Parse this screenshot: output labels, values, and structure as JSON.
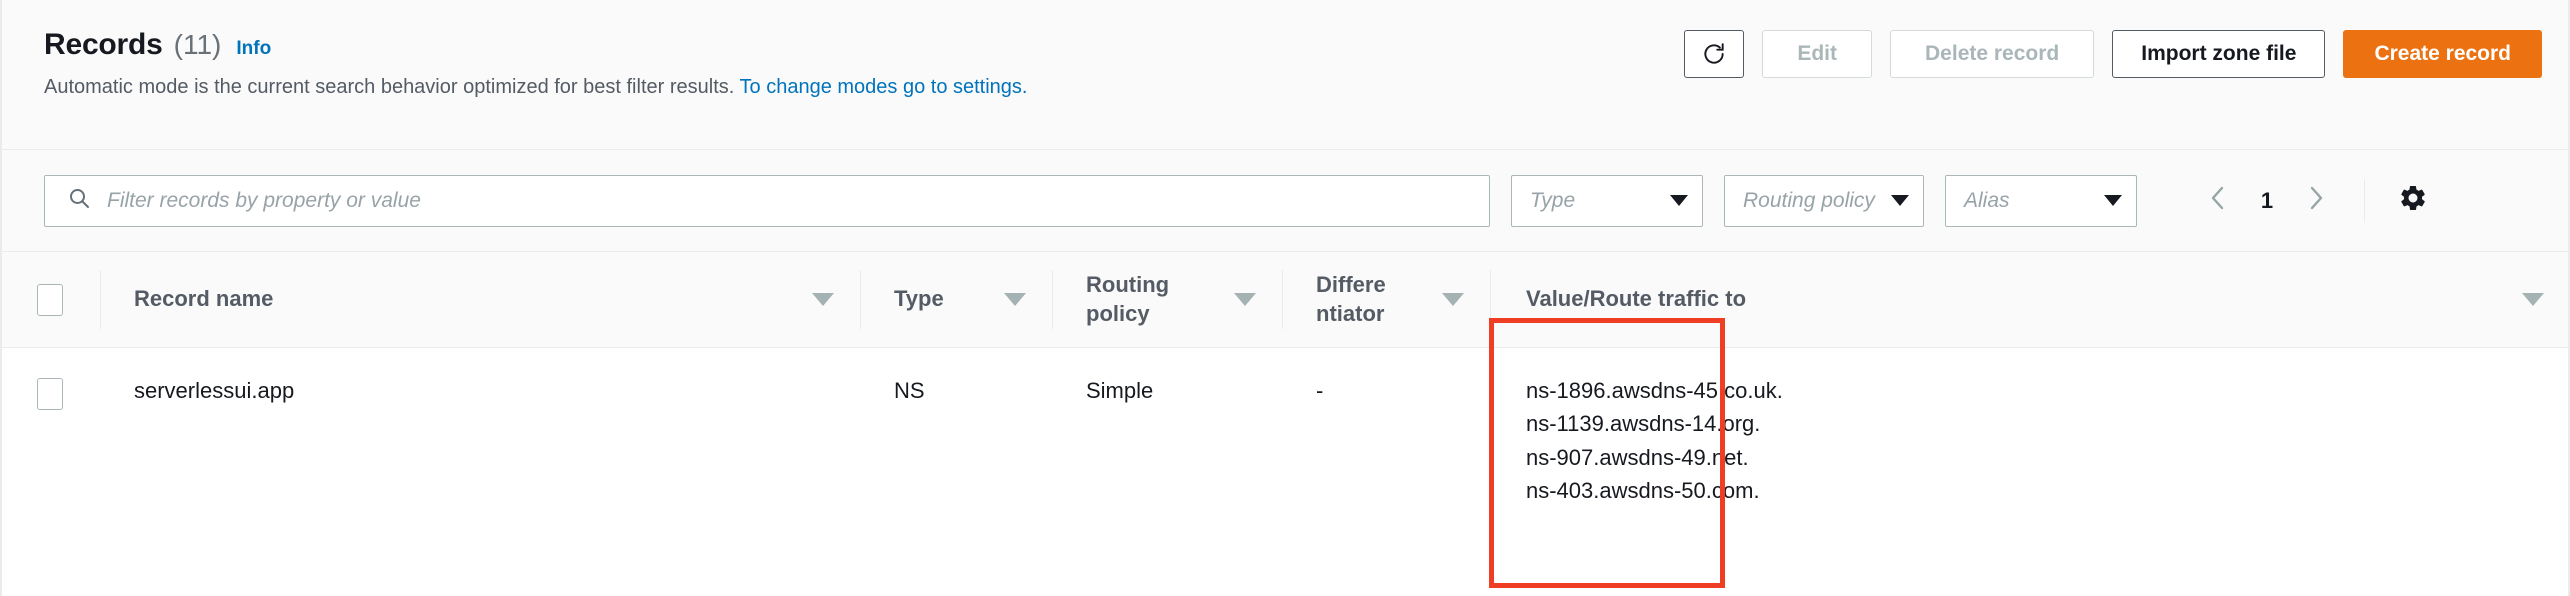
{
  "header": {
    "title": "Records",
    "count": "(11)",
    "info_link": "Info",
    "subtitle_text": "Automatic mode is the current search behavior optimized for best filter results.",
    "subtitle_link": "To change modes go to settings."
  },
  "actions": {
    "refresh_icon": "refresh-icon",
    "edit_label": "Edit",
    "delete_label": "Delete record",
    "import_label": "Import zone file",
    "create_label": "Create record",
    "primary_color": "#ec7211"
  },
  "filter": {
    "search_placeholder": "Filter records by property or value",
    "search_value": "",
    "type_label": "Type",
    "routing_label": "Routing policy",
    "alias_label": "Alias"
  },
  "pagination": {
    "prev_icon": "chevron-left-icon",
    "page": "1",
    "next_icon": "chevron-right-icon",
    "settings_icon": "gear-icon"
  },
  "table": {
    "columns": [
      {
        "label": "Record name",
        "sortable": true
      },
      {
        "label": "Type",
        "sortable": true
      },
      {
        "label": "Routing policy",
        "sortable": true
      },
      {
        "label": "Differe ntiator",
        "sortable": true
      },
      {
        "label": "Value/Route traffic to",
        "sortable": true
      }
    ],
    "rows": [
      {
        "record_name": "serverlessui.app",
        "type": "NS",
        "routing_policy": "Simple",
        "differentiator": "-",
        "values": [
          "ns-1896.awsdns-45.co.uk.",
          "ns-1139.awsdns-14.org.",
          "ns-907.awsdns-49.net.",
          "ns-403.awsdns-50.com."
        ]
      }
    ]
  },
  "annotation": {
    "color": "#ef3e24",
    "target": "Value/Route traffic to"
  }
}
